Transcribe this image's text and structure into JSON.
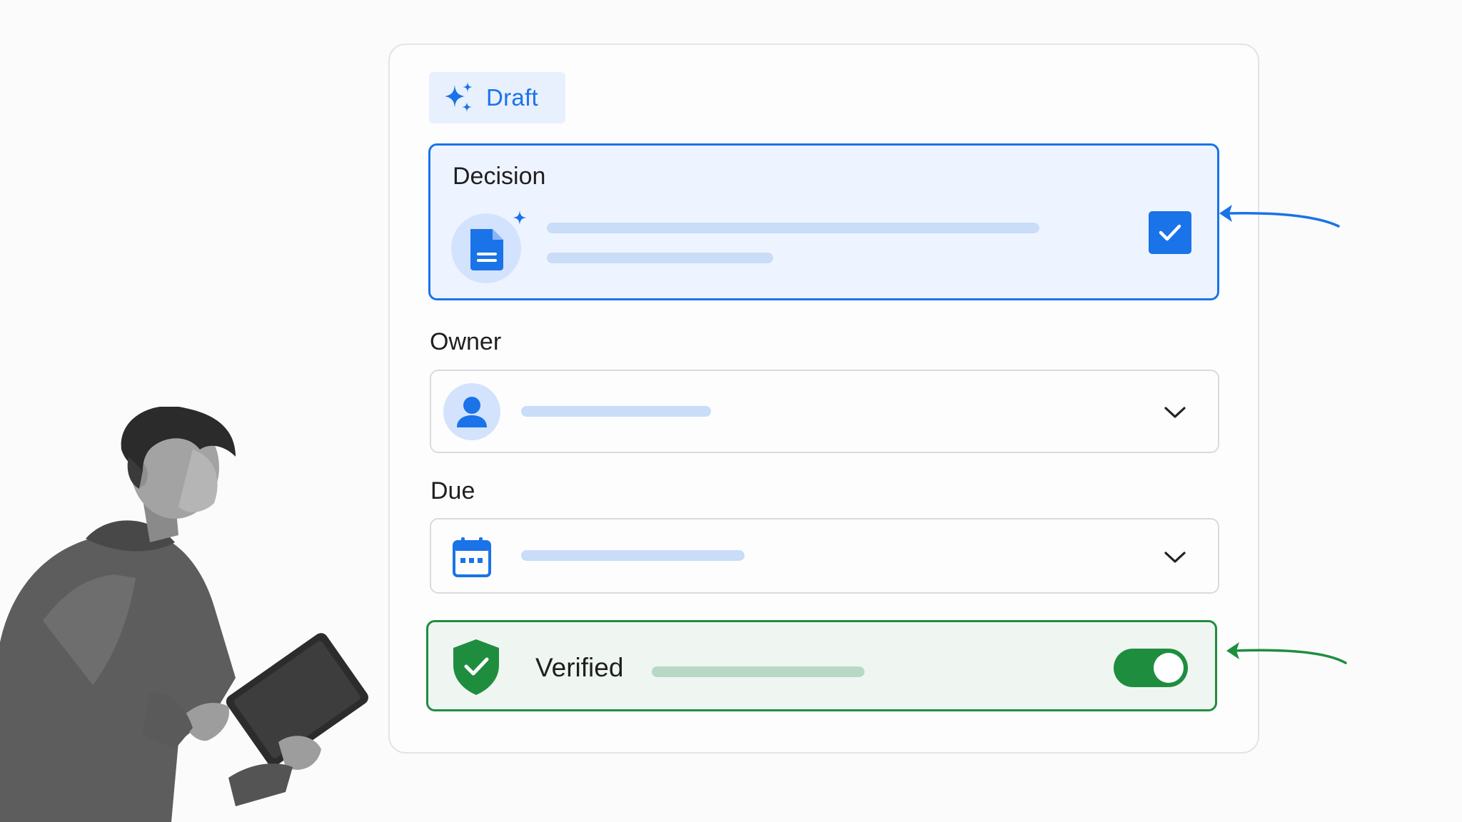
{
  "draft": {
    "label": "Draft",
    "icon": "sparkle-icon"
  },
  "decision": {
    "title": "Decision",
    "icon": "document-icon",
    "checked": true
  },
  "owner": {
    "label": "Owner",
    "icon": "person-icon"
  },
  "due": {
    "label": "Due",
    "icon": "calendar-icon"
  },
  "verified": {
    "label": "Verified",
    "icon": "shield-check-icon",
    "toggle_on": true
  },
  "colors": {
    "accent_blue": "#1a73e8",
    "accent_green": "#1e8e3e",
    "chip_bg": "#e8f0fe",
    "selected_bg": "#eef4ff",
    "verified_bg": "#eff5f1"
  }
}
